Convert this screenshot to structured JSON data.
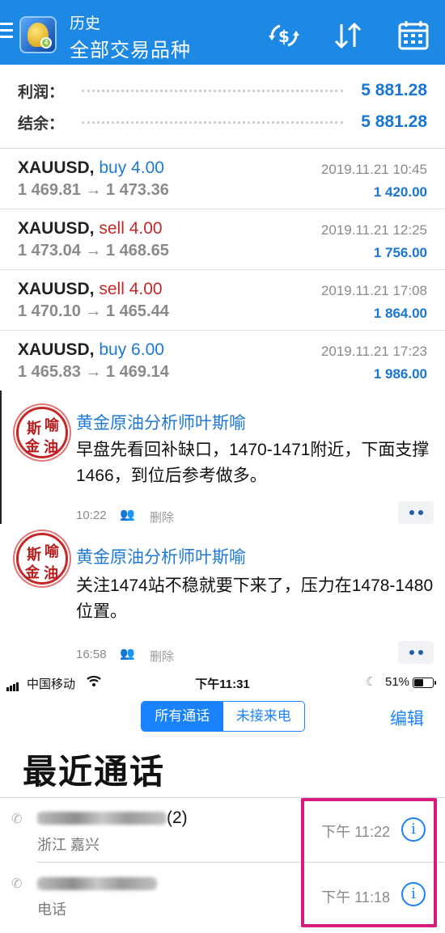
{
  "header": {
    "title": "历史",
    "subtitle": "全部交易品种",
    "icons": [
      "menu-icon",
      "app-logo-icon",
      "currency-exchange-icon",
      "sort-icon",
      "calendar-icon"
    ],
    "color": "#1e88e5"
  },
  "summary": {
    "profit_label": "利润：",
    "profit_value": "5 881.28",
    "balance_label": "结余：",
    "balance_value": "5 881.28"
  },
  "deals": [
    {
      "symbol": "XAUUSD,",
      "action": "buy 4.00",
      "type": "buy",
      "prices": "1 469.81 → 1 473.36",
      "time": "2019.11.21 10:45",
      "profit": "1 420.00"
    },
    {
      "symbol": "XAUUSD,",
      "action": "sell 4.00",
      "type": "sell",
      "prices": "1 473.04 → 1 468.65",
      "time": "2019.11.21 12:25",
      "profit": "1 756.00"
    },
    {
      "symbol": "XAUUSD,",
      "action": "sell 4.00",
      "type": "sell",
      "prices": "1 470.10 → 1 465.44",
      "time": "2019.11.21 17:08",
      "profit": "1 864.00"
    },
    {
      "symbol": "XAUUSD,",
      "action": "buy 6.00",
      "type": "buy",
      "prices": "1 465.83 → 1 469.14",
      "time": "2019.11.21 17:23",
      "profit": "1 986.00"
    }
  ],
  "messages": [
    {
      "author": "黄金原油分析师叶斯喻",
      "text": "早盘先看回补缺口，1470-1471附近，下面支撑1466，到位后参考做多。",
      "time": "10:22",
      "delete_label": "删除",
      "avatar_chars": [
        "斯",
        "喻",
        "金",
        "油"
      ]
    },
    {
      "author": "黄金原油分析师叶斯喻",
      "text": "关注1474站不稳就要下来了，压力在1478-1480位置。",
      "time": "16:58",
      "delete_label": "删除",
      "avatar_chars": [
        "斯",
        "喻",
        "金",
        "油"
      ]
    }
  ],
  "status_bar": {
    "carrier": "中国移动",
    "time": "下午11:31",
    "battery": "51%",
    "battery_level": 0.51
  },
  "phone": {
    "segment_all": "所有通话",
    "segment_missed": "未接来电",
    "edit_label": "编辑",
    "title": "最近通话",
    "calls": [
      {
        "name_suffix": "(2)",
        "location": "浙江 嘉兴",
        "time": "下午 11:22"
      },
      {
        "name_suffix": "",
        "location": "电话",
        "time": "下午 11:18"
      }
    ],
    "info_glyph": "i",
    "accent": "#1a82fb",
    "highlight_color": "#d81b7a"
  }
}
